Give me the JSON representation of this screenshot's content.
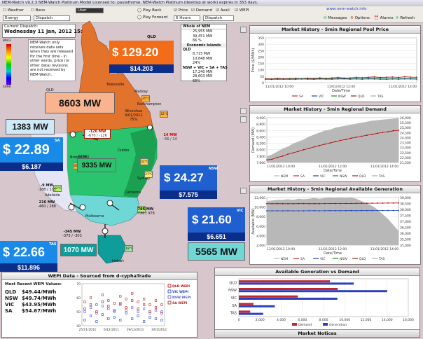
{
  "window_title": "NEM-Watch v9.2.3  NEM-Watch Platinum Model   Licensed to: paulathome.  NEM-Watch Platinum (desktop at work) expires in 353 days.",
  "brand_url": "www.nem-watch.info",
  "toolbar": {
    "weather_label": "Weather",
    "bans_label": "Bans",
    "user_label": "User",
    "energy_select": "Energy",
    "dispatch_select": "Dispatch",
    "play_back_label": "Play Back",
    "play_forward_label": "Play Forward",
    "price_label": "Price",
    "demand_label": "Demand",
    "avail_label": "Avail",
    "wepi_label": "WEPI",
    "hours_select": "6 Hours",
    "dispatch2_select": "Dispatch",
    "messages_label": "Messages",
    "options_label": "Options",
    "alarms_label": "Alarms",
    "refresh_label": "Refresh"
  },
  "current_dispatch": {
    "heading": "Current Dispatch:",
    "datetime": "Wednesday 11 Jan, 2012 15:15",
    "scale_top": "8943",
    "scale_bottom": "4096",
    "note": "NEM-Watch only receives data sets when they are released for the first time - in other words, price (or other data) revisions are not received by NEM-Watch."
  },
  "whole_of_nem": {
    "title": "Whole of NEM",
    "rows": [
      "25,955 MW",
      "39,451 MW",
      "66 %"
    ],
    "economic_islands": "Economic Islands",
    "qld_label": "QLD",
    "qld_rows": [
      "8,715 MW",
      "10,848 MW",
      "24%"
    ],
    "nsw_group_label": "NSW + VIC + SA + TAS",
    "nsw_group_rows": [
      "17,240 MW",
      "28,603 MW",
      "66%"
    ]
  },
  "regions": {
    "qld": {
      "label": "QLD",
      "price": "$ 129.20",
      "sub": "$14.203",
      "demand": "8603 MW"
    },
    "nsw": {
      "label": "NSW",
      "price": "$ 24.27",
      "sub": "$7.575",
      "demand": "9335 MW"
    },
    "vic": {
      "label": "VIC",
      "price": "$ 21.60",
      "sub": "$6.651",
      "demand": "5565 MW"
    },
    "sa": {
      "label": "SA",
      "price": "$ 22.89",
      "sub": "$6.187",
      "demand": "1383 MW"
    },
    "tas": {
      "label": "TAS",
      "price": "$ 22.66",
      "sub": "$11.896",
      "demand": "1070 MW"
    }
  },
  "flows": {
    "qni": "-126 MW",
    "qni_range": "-670 / -126",
    "terranora": "14 MW",
    "terranora_range": "-56 / 14",
    "vic_nsw": "755 MW",
    "vic_nsw_range": "-720 / 978",
    "heywood": "-9 MW",
    "heywood_range": "-188 / 113",
    "murraylink": "216 MW",
    "murraylink_range": "-460 / 288",
    "basslink": "-345 MW",
    "basslink_range": "-373 / -303",
    "wivenhoe": "Wivenhoe",
    "wivenhoe_date": "9/01/2012",
    "wivenhoe_pct": "75%"
  },
  "temps": {
    "qld_north": "34°C",
    "qld_central": "35°C",
    "qld_brisbane": "32°C",
    "nsw_coast": "32°C",
    "nsw_sydney": "27°C",
    "nsw_inland": "30°C",
    "nsw_west": "36°C",
    "vic_east": "24°C",
    "sa_city": "22°C",
    "tas_city": "18°C"
  },
  "towns": {
    "townsville": "Townsville",
    "mackay": "Mackay",
    "rockhampton": "Rockhampton",
    "broken_hill": "Broken Hill",
    "dubbo": "Dubbo",
    "sydney": "Sydney",
    "canberra": "Canberra",
    "melbourne": "Melbourne",
    "hobart": "Hobart",
    "adelaide": "Adelaide"
  },
  "price_chart": {
    "title": "Market History - 5min Regional Pool Price",
    "ylabel": "Price ($/MWh)",
    "xlabel": "Date/Time",
    "yticks": [
      "350",
      "300",
      "250",
      "200",
      "150",
      "100",
      "50",
      "0"
    ],
    "xticks": [
      "11/01/2012 10:00",
      "11/01/2012 12:00",
      "11/01/2012 14:00"
    ],
    "legend": [
      "SA",
      "VIC",
      "NSW",
      "QLD",
      "TAS"
    ]
  },
  "demand_chart": {
    "title": "Market History - 5min Regional Demand",
    "ylabel": "Demand (MW)",
    "xlabel": "Date/Time",
    "yticks": [
      "9,000",
      "8,800",
      "8,600",
      "8,400",
      "8,200",
      "8,000",
      "7,800",
      "7,600"
    ],
    "y2ticks": [
      "26,000",
      "25,500",
      "25,000",
      "24,500",
      "24,000",
      "23,500",
      "23,000",
      "22,500",
      "22,000",
      "21,500"
    ],
    "xticks": [
      "11/01/2012 10:00",
      "11/01/2012 12:00",
      "11/01/2012 14:00"
    ],
    "legend": [
      "NEM",
      "SA",
      "VIC",
      "NSW",
      "QLD",
      "TAS"
    ]
  },
  "avail_chart": {
    "title": "Market History - 5min Regional Available Generation",
    "ylabel": "Available (MW)",
    "xlabel": "Date/Time",
    "yticks": [
      "12,000",
      "10,000",
      "8,000",
      "6,000",
      "4,000",
      "2,000"
    ],
    "y2ticks": [
      "39,000",
      "38,500",
      "38,000",
      "37,500",
      "37,000",
      "36,500",
      "36,000",
      "35,500",
      "35,000"
    ],
    "xticks": [
      "11/01/2012 10:00",
      "11/01/2012 12:00",
      "11/01/2012 14:00"
    ],
    "legend": [
      "NEM",
      "SA",
      "VIC",
      "NSW",
      "QLD",
      "TAS"
    ]
  },
  "wepi": {
    "title": "WEPI Data - Sourced from d-cyphaTrade",
    "heading": "Most Recent WEPI Values:",
    "rows": [
      {
        "region": "QLD",
        "value": "$49.44/MWh"
      },
      {
        "region": "NSW",
        "value": "$49.74/MWh"
      },
      {
        "region": "VIC",
        "value": "$43.95/MWh"
      },
      {
        "region": "SA",
        "value": "$54.67/MWh"
      }
    ],
    "chart_legend": [
      "QLD WEPI",
      "VIC WEPI",
      "NSW WEPI",
      "SA WEPI"
    ],
    "xticks": [
      "25/11/2011",
      "6/12/2011",
      "19/12/2011",
      "3/01/2012"
    ],
    "yticks": [
      "70",
      "60",
      "50",
      "40"
    ]
  },
  "avail_vs_demand": {
    "title": "Available Generation vs Demand",
    "categories": [
      "QLD",
      "NSW",
      "VIC",
      "SA",
      "TAS"
    ],
    "xticks": [
      "0",
      "2,000",
      "4,000",
      "6,000",
      "8,000",
      "10,000",
      "12,000",
      "14,000",
      "16,000"
    ],
    "legend": [
      "Demand",
      "Generation"
    ],
    "market_notices": "Market Notices"
  },
  "chart_data": [
    {
      "type": "line",
      "title": "Market History - 5min Regional Pool Price",
      "xlabel": "Date/Time",
      "ylabel": "Price ($/MWh)",
      "ylim": [
        0,
        350
      ],
      "series": [
        {
          "name": "QLD",
          "color": "#c00000",
          "values": [
            32,
            30,
            34,
            31,
            33,
            35,
            32,
            36,
            34,
            38,
            35,
            37,
            40,
            36,
            38,
            41,
            39,
            42,
            45,
            40,
            42,
            44,
            41,
            46,
            43,
            42
          ]
        },
        {
          "name": "NSW",
          "color": "#118811",
          "values": [
            28,
            27,
            29,
            28,
            30,
            29,
            31,
            30,
            29,
            31,
            32,
            30,
            31,
            33,
            31,
            32,
            30,
            33,
            34,
            31,
            30,
            32,
            31,
            33,
            32,
            31
          ]
        },
        {
          "name": "VIC",
          "color": "#1a3fc0",
          "values": [
            26,
            25,
            27,
            26,
            27,
            26,
            28,
            27,
            26,
            28,
            27,
            27,
            28,
            29,
            27,
            28,
            27,
            29,
            28,
            27,
            26,
            28,
            27,
            29,
            28,
            27
          ]
        }
      ]
    },
    {
      "type": "area",
      "title": "Market History - 5min Regional Demand",
      "xlabel": "Date/Time",
      "ylabel": "Demand (MW)",
      "ylim": [
        7600,
        9000
      ],
      "y2lim": [
        21500,
        26000
      ],
      "series": [
        {
          "name": "NEM",
          "color": "#b8b8b8",
          "axis": "right",
          "values": [
            22100,
            22300,
            22600,
            22900,
            23100,
            23400,
            23600,
            23800,
            24100,
            24300,
            24500,
            24700,
            24800,
            25000,
            25100,
            25200,
            25300,
            25400,
            25500,
            25600,
            25700,
            25750,
            25800,
            25850,
            25900,
            25955
          ]
        },
        {
          "name": "QLD",
          "color": "#c00000",
          "axis": "left",
          "values": [
            7680,
            7700,
            7760,
            7800,
            7860,
            7900,
            7950,
            8000,
            8040,
            8090,
            8130,
            8170,
            8210,
            8250,
            8290,
            8320,
            8360,
            8390,
            8420,
            8450,
            8480,
            8510,
            8540,
            8560,
            8590,
            8603
          ]
        }
      ]
    },
    {
      "type": "line",
      "title": "Market History - 5min Regional Available Generation",
      "xlabel": "Date/Time",
      "ylabel": "Available (MW)",
      "ylim": [
        2000,
        12000
      ],
      "y2lim": [
        35000,
        39000
      ],
      "series": [
        {
          "name": "NEM",
          "color": "#b8b8b8",
          "axis": "right",
          "values": [
            38700,
            38750,
            38800,
            38800,
            38850,
            38800,
            38900,
            38850,
            38900,
            38950,
            38900,
            38950,
            39000,
            38950,
            39000,
            38950,
            39000,
            38900,
            38700,
            38500,
            38300,
            38000,
            37600,
            37200,
            36700,
            36200
          ]
        },
        {
          "name": "QLD",
          "color": "#c00000",
          "axis": "left",
          "values": [
            10700,
            10700,
            10720,
            10700,
            10710,
            10700,
            10720,
            10730,
            10700,
            10720,
            10710,
            10740,
            10730,
            10750,
            10740,
            10760,
            10750,
            10780,
            10790,
            10800,
            10810,
            10820,
            10830,
            10840,
            10845,
            10848
          ]
        },
        {
          "name": "VIC",
          "color": "#1a3fc0",
          "axis": "left",
          "values": [
            9200,
            9200,
            9210,
            9200,
            9220,
            9210,
            9200,
            9210,
            9220,
            9230,
            9210,
            9220,
            9230,
            9240,
            9230,
            9240,
            9250,
            9240,
            9250,
            9260,
            9250,
            9260,
            9270,
            9260,
            9270,
            9280
          ]
        }
      ]
    },
    {
      "type": "bar",
      "title": "Available Generation vs Demand",
      "categories": [
        "QLD",
        "NSW",
        "VIC",
        "SA",
        "TAS"
      ],
      "xlim": [
        0,
        16000
      ],
      "series": [
        {
          "name": "Demand",
          "color": "#c0282d",
          "values": [
            8603,
            9335,
            5565,
            1383,
            1070
          ]
        },
        {
          "name": "Generation",
          "color": "#2c3fbf",
          "values": [
            10848,
            14000,
            9300,
            3400,
            2300
          ]
        }
      ]
    },
    {
      "type": "line",
      "title": "WEPI Data - Sourced from d-cyphaTrade",
      "categories": [
        "25/11/2011",
        "6/12/2011",
        "19/12/2011",
        "3/01/2012"
      ],
      "ylim": [
        40,
        70
      ],
      "series": [
        {
          "name": "QLD WEPI",
          "color": "#c00000",
          "values": [
            52,
            55,
            50,
            57,
            54,
            51,
            56,
            53,
            58,
            52,
            55,
            50,
            53,
            49
          ]
        },
        {
          "name": "VIC WEPI",
          "color": "#1a3fc0",
          "values": [
            44,
            47,
            43,
            48,
            45,
            46,
            44,
            49,
            45,
            47,
            43,
            46,
            45,
            44
          ]
        },
        {
          "name": "NSW WEPI",
          "color": "#5555dd",
          "values": [
            50,
            53,
            49,
            54,
            52,
            50,
            55,
            51,
            53,
            50,
            52,
            49,
            51,
            50
          ]
        },
        {
          "name": "SA WEPI",
          "color": "#aa2222",
          "values": [
            57,
            60,
            55,
            62,
            58,
            56,
            61,
            59,
            63,
            57,
            59,
            55,
            58,
            55
          ]
        }
      ]
    }
  ]
}
